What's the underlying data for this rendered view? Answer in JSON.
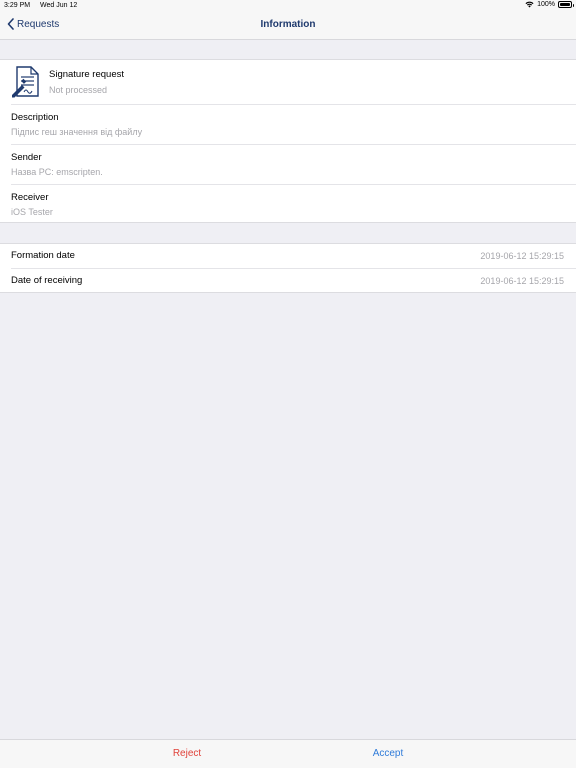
{
  "status": {
    "time": "3:29 PM",
    "date": "Wed Jun 12",
    "battery_percent": "100%",
    "battery_level": 1.0
  },
  "nav": {
    "back_label": "Requests",
    "title": "Information"
  },
  "signature": {
    "title": "Signature request",
    "status": "Not processed",
    "icon": "signed-document-icon"
  },
  "details": [
    {
      "label": "Description",
      "value": "Підпис геш значення від файлу"
    },
    {
      "label": "Sender",
      "value": "Назва PC: emscripten."
    },
    {
      "label": "Receiver",
      "value": "iOS Tester"
    }
  ],
  "dates": [
    {
      "label": "Formation date",
      "value": "2019-06-12 15:29:15"
    },
    {
      "label": "Date of receiving",
      "value": "2019-06-12 15:29:15"
    }
  ],
  "actions": {
    "reject_label": "Reject",
    "accept_label": "Accept"
  },
  "colors": {
    "nav_text": "#1f3a6e",
    "reject": "#e0423a",
    "accept": "#2f7bd9",
    "background": "#efeff4"
  }
}
